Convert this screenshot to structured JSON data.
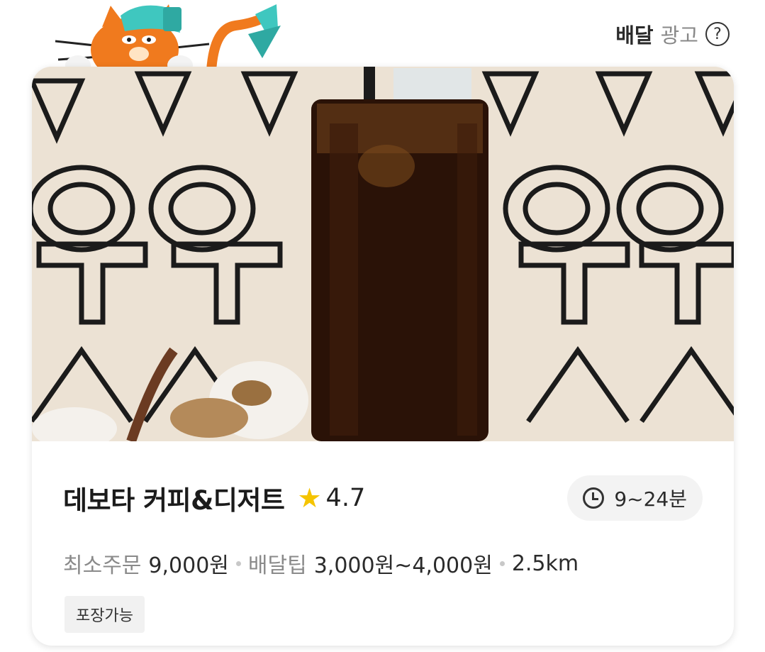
{
  "header": {
    "brand": "배달",
    "ad_text": "광고",
    "help_symbol": "?"
  },
  "card": {
    "store_name": "데보타 커피&디저트",
    "star": "★",
    "rating": "4.7",
    "delivery_time": "9~24분",
    "min_order_label": "최소주문",
    "min_order_value": "9,000원",
    "tip_label": "배달팁",
    "tip_value": "3,000원~4,000원",
    "distance": "2.5km",
    "tag": "포장가능"
  },
  "colors": {
    "star": "#f5c400",
    "chip_bg": "#f3f3f3",
    "label_gray": "#8a8a8a"
  },
  "icons": {
    "mascot": "orange-cat-mascot",
    "help": "question-circle-icon",
    "time": "clock-icon",
    "rating": "star-icon"
  }
}
